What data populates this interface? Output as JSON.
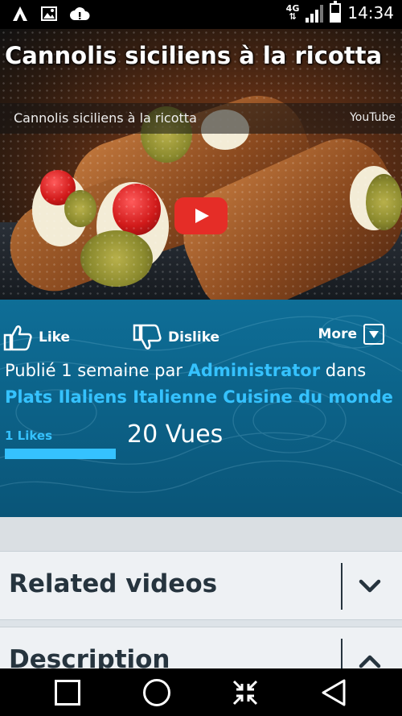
{
  "status_bar": {
    "network": "4G",
    "time": "14:34",
    "battery_level": 0.5,
    "signal_bars": 3
  },
  "video": {
    "page_title": "Cannolis siciliens à la ricotta",
    "embed_title": "Cannolis siciliens à la ricotta",
    "embed_brand": "YouTube"
  },
  "actions": {
    "like_label": "Like",
    "dislike_label": "Dislike",
    "more_label": "More"
  },
  "meta": {
    "published_prefix": "Publié 1 semaine par ",
    "author": "Administrator",
    "in_word": " dans",
    "categories": "Plats Ilaliens Italienne Cuisine du monde"
  },
  "stats": {
    "likes_label": "1 Likes",
    "likes_fraction": 1.0,
    "views_label": "20 Vues"
  },
  "sections": {
    "related_label": "Related videos",
    "description_label": "Description"
  },
  "colors": {
    "panel_blue": "#0e6e97",
    "link_blue": "#35c2ff",
    "youtube_red": "#e52d27",
    "section_text": "#26343e"
  }
}
